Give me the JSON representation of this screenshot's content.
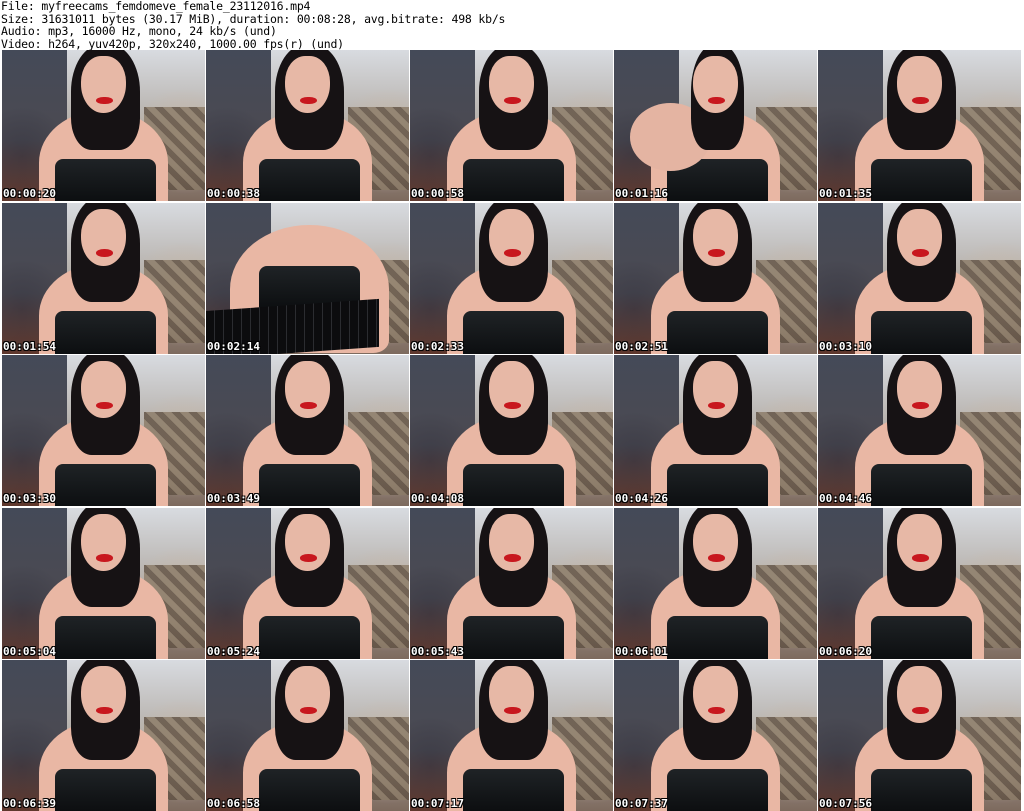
{
  "header": {
    "file": "File: myfreecams_femdomeve_female_23112016.mp4",
    "size": "Size: 31631011 bytes (30.17 MiB), duration: 00:08:28, avg.bitrate: 498 kb/s",
    "audio": "Audio: mp3, 16000 Hz, mono, 24 kb/s (und)",
    "video": "Video: h264, yuv420p, 320x240, 1000.00 fps(r) (und)"
  },
  "thumbnails": [
    {
      "time": "00:00:20"
    },
    {
      "time": "00:00:38"
    },
    {
      "time": "00:00:58"
    },
    {
      "time": "00:01:16"
    },
    {
      "time": "00:01:35"
    },
    {
      "time": "00:01:54"
    },
    {
      "time": "00:02:14"
    },
    {
      "time": "00:02:33"
    },
    {
      "time": "00:02:51"
    },
    {
      "time": "00:03:10"
    },
    {
      "time": "00:03:30"
    },
    {
      "time": "00:03:49"
    },
    {
      "time": "00:04:08"
    },
    {
      "time": "00:04:26"
    },
    {
      "time": "00:04:46"
    },
    {
      "time": "00:05:04"
    },
    {
      "time": "00:05:24"
    },
    {
      "time": "00:05:43"
    },
    {
      "time": "00:06:01"
    },
    {
      "time": "00:06:20"
    },
    {
      "time": "00:06:39"
    },
    {
      "time": "00:06:58"
    },
    {
      "time": "00:07:17"
    },
    {
      "time": "00:07:37"
    },
    {
      "time": "00:07:56"
    }
  ]
}
